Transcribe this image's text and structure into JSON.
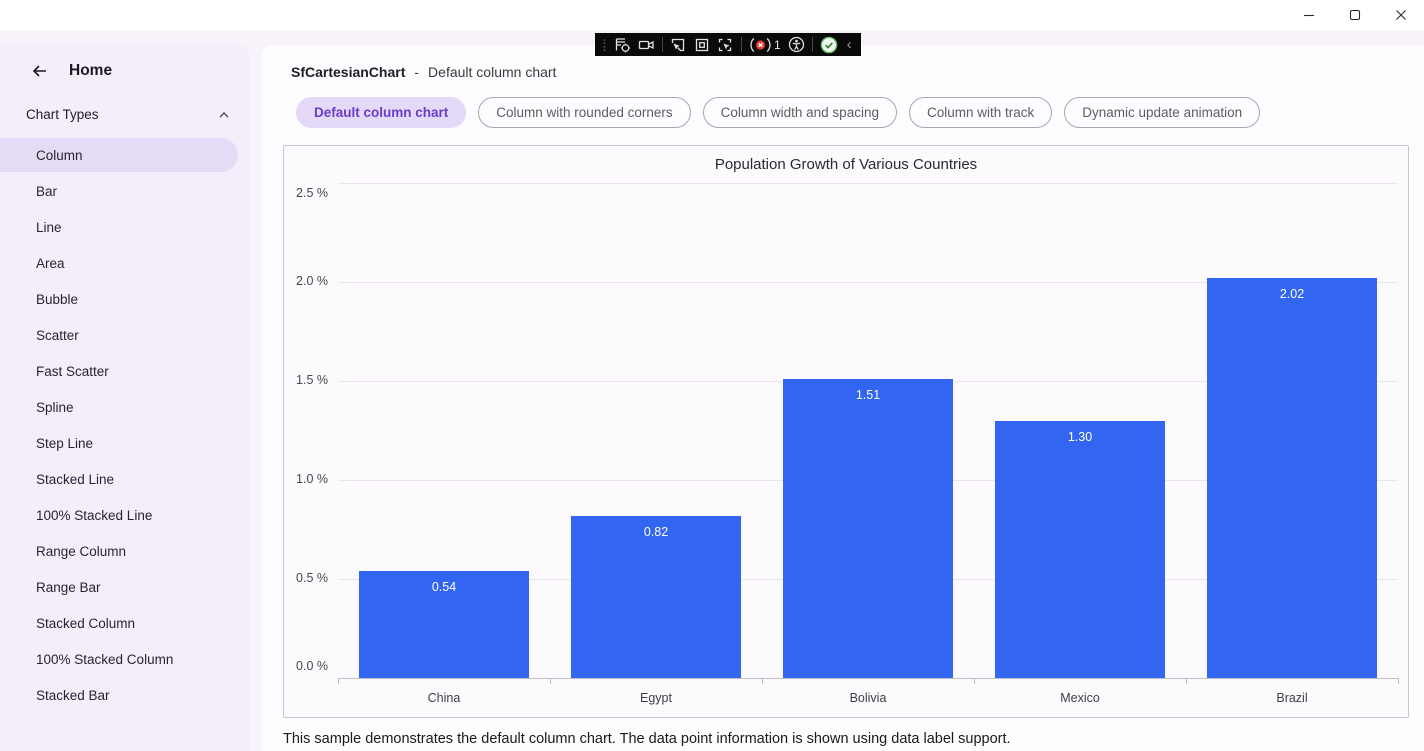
{
  "window": {
    "controls": {
      "minimize": "minimize",
      "maximize": "maximize",
      "close": "close"
    }
  },
  "capture_toolbar": {
    "record_count": "1",
    "icons": [
      "grip",
      "element-target",
      "camera",
      "cursor-select",
      "frame-inspect",
      "cursor-frame",
      "record-issues",
      "accessibility",
      "check-status",
      "collapse-chevron"
    ]
  },
  "colors": {
    "accent_purple": "#6a3dc8",
    "selected_pill_purple": "#e6dbf7",
    "bar_blue": "#3366f0",
    "record_red": "#e53935",
    "check_green": "#2e7d32",
    "sidebar_bg": "#f5eefa"
  },
  "sidebar": {
    "header": "Home",
    "section": "Chart Types",
    "items": [
      {
        "label": "Column",
        "selected": true
      },
      {
        "label": "Bar",
        "selected": false
      },
      {
        "label": "Line",
        "selected": false
      },
      {
        "label": "Area",
        "selected": false
      },
      {
        "label": "Bubble",
        "selected": false
      },
      {
        "label": "Scatter",
        "selected": false
      },
      {
        "label": "Fast Scatter",
        "selected": false
      },
      {
        "label": "Spline",
        "selected": false
      },
      {
        "label": "Step Line",
        "selected": false
      },
      {
        "label": "Stacked Line",
        "selected": false
      },
      {
        "label": "100% Stacked Line",
        "selected": false
      },
      {
        "label": "Range Column",
        "selected": false
      },
      {
        "label": "Range Bar",
        "selected": false
      },
      {
        "label": "Stacked Column",
        "selected": false
      },
      {
        "label": "100% Stacked Column",
        "selected": false
      },
      {
        "label": "Stacked Bar",
        "selected": false
      }
    ]
  },
  "main": {
    "breadcrumb": {
      "control": "SfCartesianChart",
      "separator": "-",
      "sample": "Default column chart"
    },
    "tabs": [
      {
        "label": "Default column chart",
        "selected": true
      },
      {
        "label": "Column with rounded corners",
        "selected": false
      },
      {
        "label": "Column width and spacing",
        "selected": false
      },
      {
        "label": "Column with track",
        "selected": false
      },
      {
        "label": "Dynamic update animation",
        "selected": false
      }
    ],
    "description": "This sample demonstrates the default column chart. The data point information is shown using data label support."
  },
  "chart_data": {
    "type": "bar",
    "title": "Population Growth of Various Countries",
    "categories": [
      "China",
      "Egypt",
      "Bolivia",
      "Mexico",
      "Brazil"
    ],
    "values": [
      0.54,
      0.82,
      1.51,
      1.3,
      2.02
    ],
    "data_labels": [
      "0.54",
      "0.82",
      "1.51",
      "1.30",
      "2.02"
    ],
    "xlabel": "",
    "ylabel": "",
    "y_ticks": [
      "2.5 %",
      "2.0 %",
      "1.5 %",
      "1.0 %",
      "0.5 %",
      "0.0 %"
    ],
    "ylim": [
      0,
      2.5
    ],
    "grid": "horizontal",
    "legend": "none",
    "bar_color": "#3366f0"
  }
}
